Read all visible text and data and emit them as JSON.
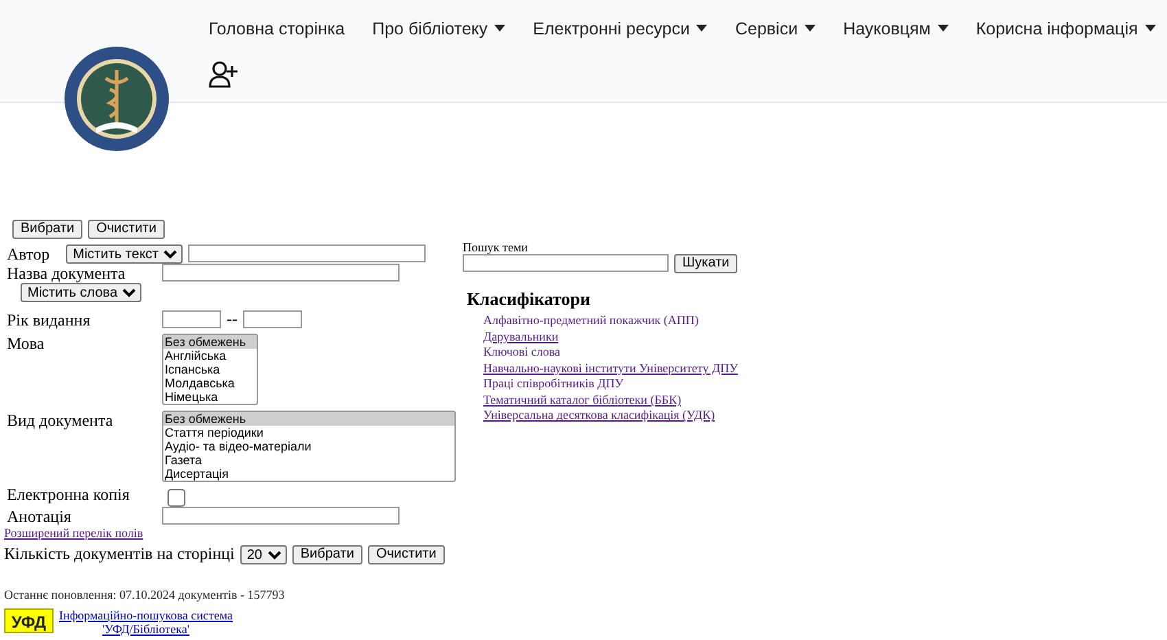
{
  "nav": {
    "items": [
      {
        "label": "Головна сторінка",
        "dropdown": false
      },
      {
        "label": "Про бібліотеку",
        "dropdown": true
      },
      {
        "label": "Електронні ресурси",
        "dropdown": true
      },
      {
        "label": "Сервіси",
        "dropdown": true
      },
      {
        "label": "Науковцям",
        "dropdown": true
      },
      {
        "label": "Корисна інформація",
        "dropdown": true
      }
    ]
  },
  "form": {
    "top_buttons": [
      "Вибрати",
      "Очистити"
    ],
    "fields": [
      {
        "kind": "text",
        "label": "Автор",
        "operator": "Містить текст"
      },
      {
        "kind": "text",
        "label": "Назва документа",
        "operator_below": "Містить слова"
      },
      {
        "kind": "range",
        "label": "Рік видання",
        "separator": "--"
      },
      {
        "kind": "list",
        "label": "Мова",
        "options": [
          {
            "label": "Без обмежень",
            "selected": true
          },
          {
            "label": "Англійська",
            "selected": false
          },
          {
            "label": "Іспанська",
            "selected": false
          },
          {
            "label": "Молдавська",
            "selected": false
          },
          {
            "label": "Німецька",
            "selected": false
          }
        ]
      },
      {
        "kind": "widelist",
        "label": "Вид документа",
        "options": [
          {
            "label": "Без обмежень",
            "selected": true
          },
          {
            "label": "Стаття періодики",
            "selected": false
          },
          {
            "label": "Аудіо- та відео-матеріали",
            "selected": false
          },
          {
            "label": "Газета",
            "selected": false
          },
          {
            "label": "Дисертація",
            "selected": false
          }
        ]
      },
      {
        "kind": "checkbox",
        "label": "Електронна копія",
        "checked": false
      },
      {
        "kind": "text",
        "label": "Анотація"
      }
    ],
    "extended_link": "Розширений перелік полів",
    "page_size": {
      "label": "Кількість документів на сторінці",
      "value": "20"
    },
    "bottom_buttons": [
      "Вибрати",
      "Очистити"
    ]
  },
  "topic_search": {
    "label": "Пошук теми",
    "button": "Шукати"
  },
  "classifiers": {
    "title": "Класифікатори",
    "items": [
      {
        "label": "Алфавітно-предметний покажчик (АПП)",
        "underlined": false
      },
      {
        "label": "Дарувальники",
        "underlined": true
      },
      {
        "label": "Ключові слова",
        "underlined": false
      },
      {
        "label": "Навчально-наукові інститути Університету ДПУ",
        "underlined": true
      },
      {
        "label": "Праці співробітників ДПУ",
        "underlined": false
      },
      {
        "label": "Тематичний каталог бібліотеки (ББК)",
        "underlined": true
      },
      {
        "label": "Універсальна десяткова класифікація (УДК)",
        "underlined": true
      }
    ]
  },
  "footer": {
    "last_update": "Останнє поновлення: 07.10.2024 документів - 157793",
    "logo_text": "УФД",
    "link_lines": [
      "Інформаційно-пошукова система",
      "'УФД/Бібліотека'"
    ]
  }
}
